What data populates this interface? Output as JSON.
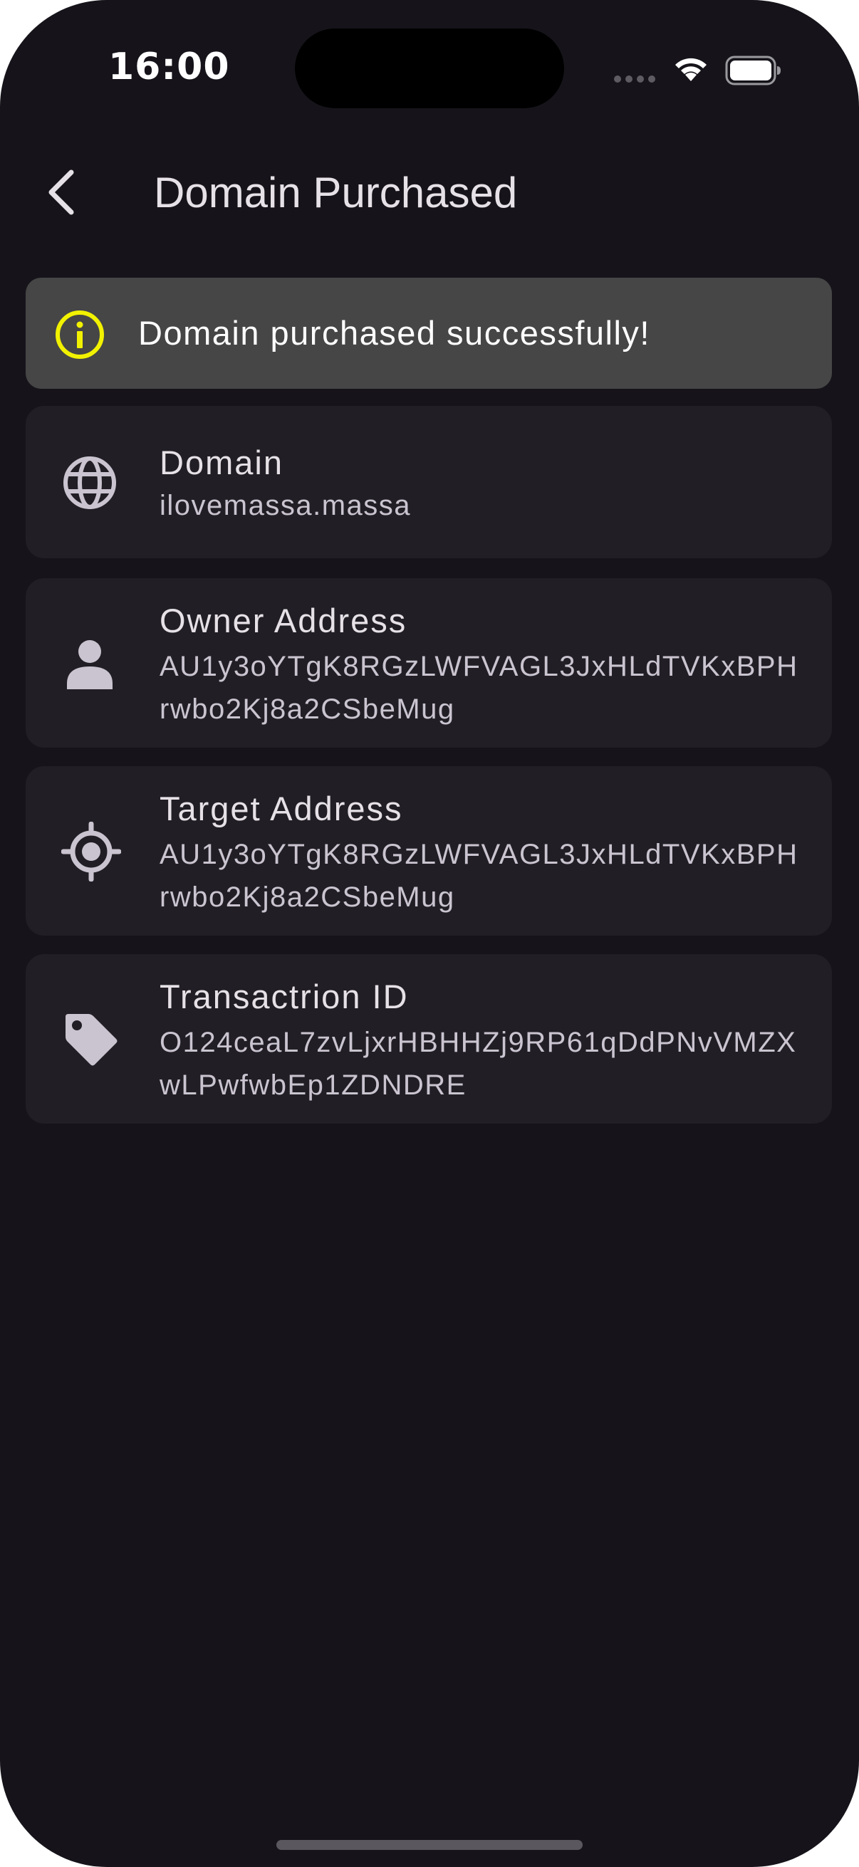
{
  "status_bar": {
    "time": "16:00"
  },
  "header": {
    "title": "Domain Purchased"
  },
  "banner": {
    "message": "Domain purchased successfully!"
  },
  "cards": [
    {
      "label": "Domain",
      "value": "ilovemassa.massa",
      "icon": "globe-icon"
    },
    {
      "label": "Owner Address",
      "value": "AU1y3oYTgK8RGzLWFVAGL3JxHLdTVKxBPHrwbo2Kj8a2CSbeMug",
      "icon": "person-icon"
    },
    {
      "label": "Target Address",
      "value": "AU1y3oYTgK8RGzLWFVAGL3JxHLdTVKxBPHrwbo2Kj8a2CSbeMug",
      "icon": "target-icon"
    },
    {
      "label": "Transactrion ID",
      "value": "O124ceaL7zvLjxrHBHHZj9RP61qDdPNvVMZXwLPwfwbEp1ZDNDRE",
      "icon": "tag-icon"
    }
  ],
  "colors": {
    "background": "#16141a",
    "card": "#211f25",
    "banner": "#464646",
    "info_accent": "#f2f200"
  }
}
